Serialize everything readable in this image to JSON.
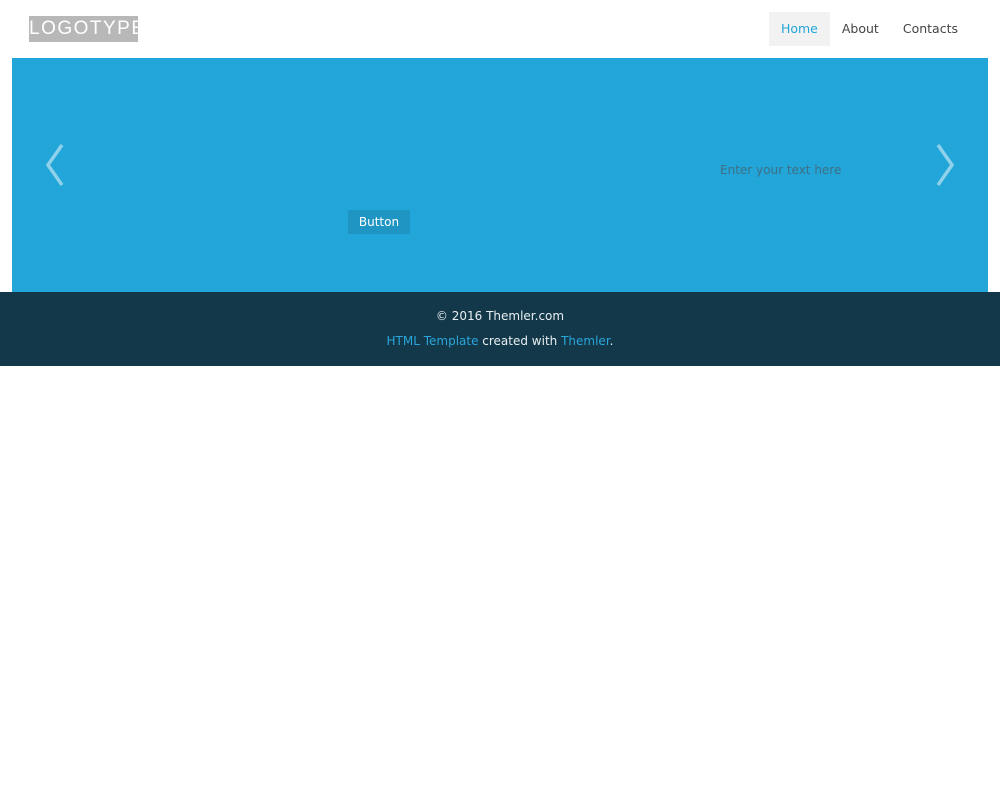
{
  "header": {
    "logo_text": "LOGOTYPE",
    "nav": [
      {
        "label": "Home",
        "active": true
      },
      {
        "label": "About",
        "active": false
      },
      {
        "label": "Contacts",
        "active": false
      }
    ]
  },
  "slider": {
    "prev_icon": "chevron-left-icon",
    "next_icon": "chevron-right-icon",
    "text": "Enter your text here",
    "button_label": "Button"
  },
  "footer": {
    "copyright": "© 2016 Themler.com",
    "credit_link_1": "HTML Template",
    "credit_middle": " created with ",
    "credit_link_2": "Themler",
    "credit_end": "."
  },
  "colors": {
    "accent": "#23a5d7",
    "slider_background": "#22a5d8",
    "footer_background": "#123849",
    "logo_background": "#b8b8b8"
  }
}
